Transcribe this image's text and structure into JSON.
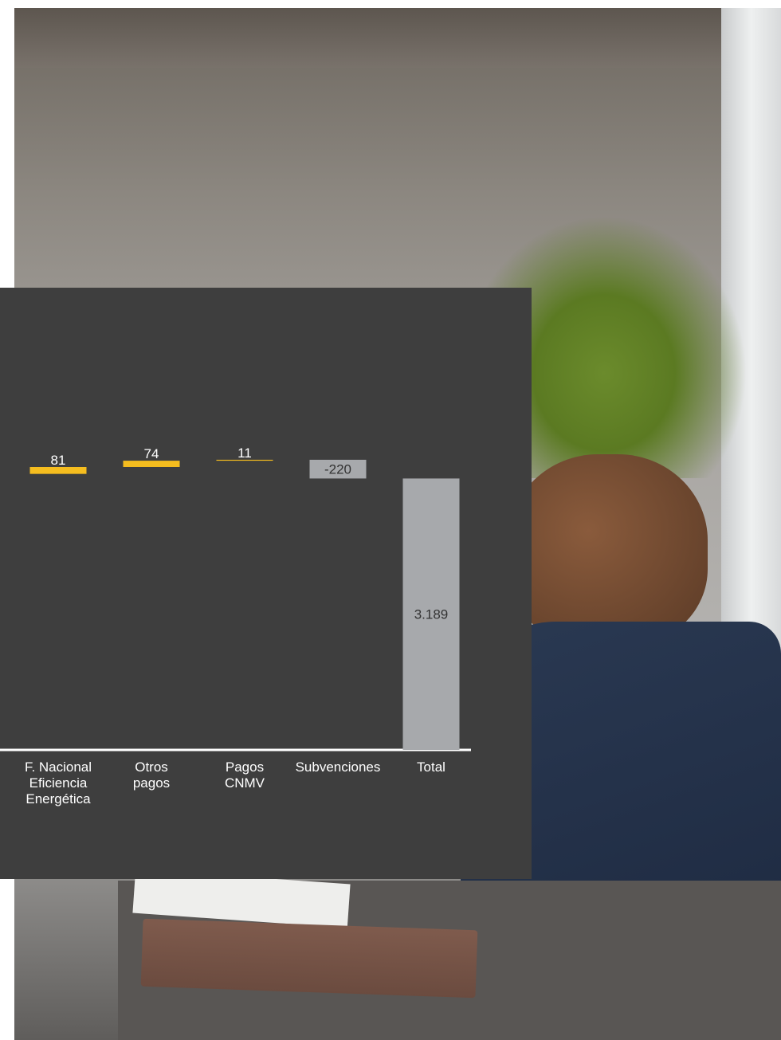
{
  "chart_data": {
    "type": "bar",
    "subtype": "waterfall",
    "categories": [
      "F. Nacional\nEficiencia\nEnergética",
      "Otros\npagos",
      "Pagos\nCNMV",
      "Subvenciones",
      "Total"
    ],
    "values": [
      81,
      74,
      11,
      -220,
      3189
    ],
    "value_labels": [
      "81",
      "74",
      "11",
      "-220",
      "3.189"
    ],
    "colors": {
      "positive": "#f5bd1f",
      "negative": "#a7a9ac",
      "total": "#a7a9ac",
      "panel_background": "#3e3e3e",
      "axis": "#ffffff",
      "label_on_light": "#333333",
      "label_on_dark": "#ffffff"
    },
    "ylim": [
      0,
      3315
    ],
    "grid": false,
    "legend": "none"
  }
}
